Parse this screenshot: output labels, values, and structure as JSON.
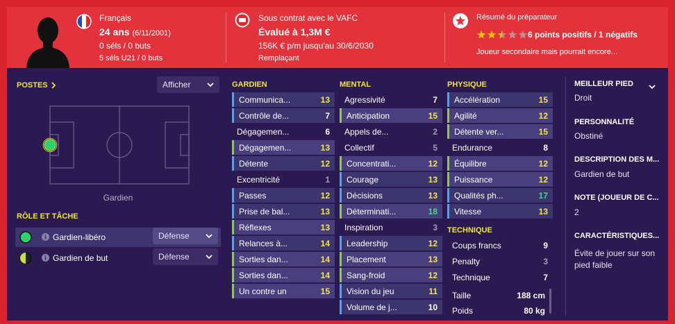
{
  "header": {
    "nationality": "Français",
    "age": "24 ans",
    "dob": "(6/11/2001)",
    "caps": "0 séls / 0 buts",
    "u21": "5 séls U21 / 0 buts",
    "contract": "Sous contrat avec le VAFC",
    "value": "Évalué à 1,3M €",
    "wage": "156K € p/m jusqu'au 30/6/2030",
    "status": "Remplaçant",
    "report_title": "Résumé du préparateur",
    "report_stars": 2.5,
    "report_summary": "6 points positifs / 1 négatifs",
    "report_text": "Joueur secondaire mais pourrait encore..."
  },
  "positions": {
    "title": "POSTES",
    "dropdown": "Afficher",
    "position_label": "Gardien"
  },
  "roles": {
    "title": "RÔLE ET TÂCHE",
    "items": [
      {
        "name": "Gardien-libéro",
        "duty": "Défense"
      },
      {
        "name": "Gardien de but",
        "duty": "Défense"
      }
    ]
  },
  "attributes": {
    "goalkeeper": {
      "title": "GARDIEN",
      "rows": [
        {
          "name": "Communica...",
          "value": "13"
        },
        {
          "name": "Contrôle de...",
          "value": "7"
        },
        {
          "name": "Dégagemen...",
          "value": "6"
        },
        {
          "name": "Dégagemen...",
          "value": "13"
        },
        {
          "name": "Détente",
          "value": "12"
        },
        {
          "name": "Excentricité",
          "value": "1"
        },
        {
          "name": "Passes",
          "value": "12"
        },
        {
          "name": "Prise de bal...",
          "value": "13"
        },
        {
          "name": "Réflexes",
          "value": "13"
        },
        {
          "name": "Relances à...",
          "value": "14"
        },
        {
          "name": "Sorties dan...",
          "value": "14"
        },
        {
          "name": "Sorties dan...",
          "value": "14"
        },
        {
          "name": "Un contre un",
          "value": "15"
        }
      ]
    },
    "mental": {
      "title": "MENTAL",
      "rows": [
        {
          "name": "Agressivité",
          "value": "7"
        },
        {
          "name": "Anticipation",
          "value": "15"
        },
        {
          "name": "Appels de...",
          "value": "2"
        },
        {
          "name": "Collectif",
          "value": "5"
        },
        {
          "name": "Concentrati...",
          "value": "12"
        },
        {
          "name": "Courage",
          "value": "13"
        },
        {
          "name": "Décisions",
          "value": "13"
        },
        {
          "name": "Déterminati...",
          "value": "18"
        },
        {
          "name": "Inspiration",
          "value": "3"
        },
        {
          "name": "Leadership",
          "value": "12"
        },
        {
          "name": "Placement",
          "value": "13"
        },
        {
          "name": "Sang-froid",
          "value": "12"
        },
        {
          "name": "Vision du jeu",
          "value": "11"
        },
        {
          "name": "Volume de j...",
          "value": "10"
        }
      ]
    },
    "physical": {
      "title": "PHYSIQUE",
      "rows": [
        {
          "name": "Accélération",
          "value": "15"
        },
        {
          "name": "Agilité",
          "value": "12"
        },
        {
          "name": "Détente ver...",
          "value": "15"
        },
        {
          "name": "Endurance",
          "value": "8"
        },
        {
          "name": "Équilibre",
          "value": "12"
        },
        {
          "name": "Puissance",
          "value": "12"
        },
        {
          "name": "Qualités ph...",
          "value": "17"
        },
        {
          "name": "Vitesse",
          "value": "13"
        }
      ]
    },
    "technical": {
      "title": "TECHNIQUE",
      "rows": [
        {
          "name": "Coups francs",
          "value": "9"
        },
        {
          "name": "Penalty",
          "value": "3"
        },
        {
          "name": "Technique",
          "value": "7"
        }
      ]
    },
    "size": {
      "height_label": "Taille",
      "height_value": "188 cm",
      "weight_label": "Poids",
      "weight_value": "80 kg"
    }
  },
  "profile": {
    "best_foot_label": "MEILLEUR PIED",
    "best_foot": "Droit",
    "personality_label": "PERSONNALITÉ",
    "personality": "Obstiné",
    "description_label": "DESCRIPTION DES M...",
    "description": "Gardien de but",
    "note_label": "NOTE (JOUEUR DE C...",
    "note": "2",
    "traits_label": "CARACTÉRISTIQUES...",
    "traits": "Évite de jouer sur son pied faible"
  },
  "colors": {
    "accent_red": "#e3323b",
    "background": "#2b1a52",
    "header_yellow": "#f0e442",
    "value_yellow": "#f3e44b",
    "value_green": "#3ddc84",
    "value_grey": "#a39cb8",
    "highlight_row": "#4a3f7e",
    "key_row": "#3d3570"
  }
}
